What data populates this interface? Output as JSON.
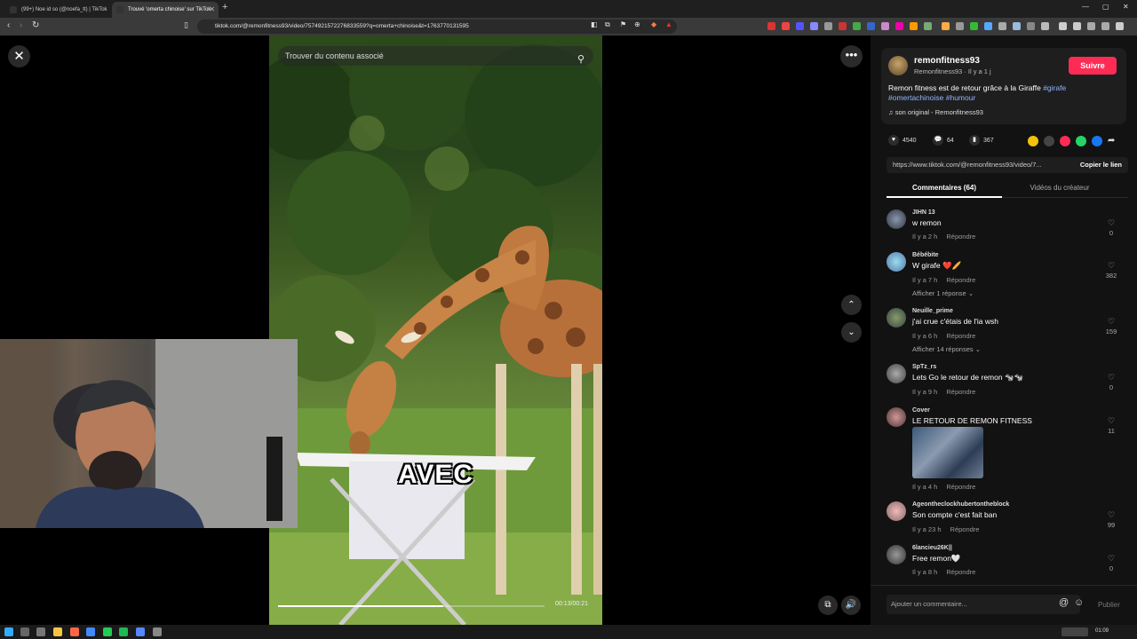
{
  "browser": {
    "tabs": [
      {
        "label": "(99+) Noe id so (@noefa_tt) | TikTok"
      },
      {
        "label": "Trouvé 'omerta chinoise' sur TikTok"
      }
    ],
    "new_tab": "+",
    "url": "tiktok.com/@remonfitness93/video/7574921572276833559?q=omerta+chinoise&t=1763770131595"
  },
  "video": {
    "search_placeholder": "Trouver du contenu associé",
    "overlay_text": "AVEC",
    "time": "00:13/00:21",
    "progress": 0.62
  },
  "panel": {
    "author": {
      "name": "remonfitness93",
      "sub": "Remonfitness93 · Il y a 1 j",
      "follow": "Suivre"
    },
    "description": "Remon fitness est de retour grâce à la Giraffe ",
    "hashtags": [
      "#girafe",
      "#omertachinoise",
      "#humour"
    ],
    "music": "son original - Remonfitness93",
    "actions": {
      "likes": "4540",
      "comments": "64",
      "saves": "367"
    },
    "share_colors": [
      "#f4c20d",
      "#444444",
      "#fe2c55",
      "#25d366",
      "#1877f2"
    ],
    "link": {
      "url": "https://www.tiktok.com/@remonfitness93/video/7...",
      "copy": "Copier le lien"
    },
    "tabs": {
      "comments": "Commentaires (64)",
      "videos": "Vidéos du créateur"
    },
    "comments": [
      {
        "user": "JIHN 13",
        "text": "w remon",
        "time": "Il y a 2 h",
        "reply": "Répondre",
        "likes": "0"
      },
      {
        "user": "Bébébite",
        "text": "W girafe ❤️🥖",
        "time": "Il y a 7 h",
        "reply": "Répondre",
        "likes": "382",
        "more": "Afficher 1 réponse ⌄"
      },
      {
        "user": "Neuille_prime",
        "text": "j'ai crue c'étais de l'ia wsh",
        "time": "Il y a 6 h",
        "reply": "Répondre",
        "likes": "159",
        "more": "Afficher 14 réponses ⌄"
      },
      {
        "user": "SpTz_rs",
        "text": "Lets Go le retour de remon 🐄🐄",
        "time": "Il y a 9 h",
        "reply": "Répondre",
        "likes": "0"
      },
      {
        "user": "Cover",
        "text": "LE RETOUR DE REMON FITNESS",
        "time": "Il y a 4 h",
        "reply": "Répondre",
        "likes": "11"
      },
      {
        "user": "Ageontheclockhubertontheblock",
        "text": "Son compte c'est fait ban",
        "time": "Il y a 23 h",
        "reply": "Répondre",
        "likes": "99"
      },
      {
        "user": "6lancieu26K||",
        "text": "Free remon🤍",
        "time": "Il y a 8 h",
        "reply": "Répondre",
        "likes": "0"
      }
    ],
    "comment_placeholder": "Ajouter un commentaire...",
    "publish": "Publier"
  },
  "taskbar": {
    "clock": "01:09"
  }
}
